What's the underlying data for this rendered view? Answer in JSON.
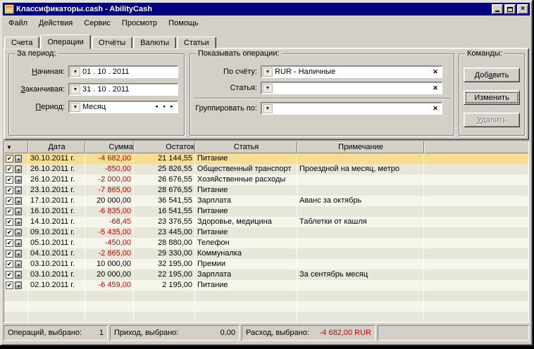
{
  "icons": {
    "dropdown": "▼",
    "clear": "✕",
    "spin_left": "◄",
    "spin_dot": "●",
    "spin_right": "►",
    "check": "✔",
    "sort": "▼"
  },
  "colors": {
    "titlebar": "#000080",
    "chrome": "#d4d0c8",
    "negative_red": "#cc0000",
    "selected_row": "#f5dd95",
    "stripe_dark": "#e7e7d9",
    "stripe_light": "#f5f5ec"
  },
  "window": {
    "title": "Классификаторы.cash - AbilityCash"
  },
  "menu": {
    "items": [
      "Файл",
      "Действия",
      "Сервис",
      "Просмотр",
      "Помощь"
    ]
  },
  "tabs": [
    {
      "label": "Счета",
      "active": false
    },
    {
      "label": "Операции",
      "active": true
    },
    {
      "label": "Отчёты",
      "active": false
    },
    {
      "label": "Валюты",
      "active": false
    },
    {
      "label": "Статьи",
      "active": false
    }
  ],
  "period_group": {
    "title": "За период:",
    "fields": [
      {
        "label": "Начиная:",
        "value": "01 . 10 . 2011"
      },
      {
        "label": "Заканчивая:",
        "value": "31 . 10 . 2011"
      },
      {
        "label": "Период:",
        "value": "Месяц"
      }
    ]
  },
  "filter_group": {
    "title": "Показывать операции:",
    "fields": [
      {
        "label": "По счёту:",
        "value": "RUR - Наличные"
      },
      {
        "label": "Статья:",
        "value": ""
      },
      {
        "label": "Группировать по:",
        "value": ""
      }
    ]
  },
  "commands_group": {
    "title": "Команды:",
    "buttons": [
      {
        "label": "Добавить",
        "focused": false,
        "disabled": false
      },
      {
        "label": "Изменить",
        "focused": true,
        "disabled": false
      },
      {
        "label": "Удалить",
        "focused": false,
        "disabled": true
      }
    ]
  },
  "table": {
    "columns": [
      "",
      "Дата",
      "Сумма",
      "Остаток",
      "Статья",
      "Примечание",
      ""
    ],
    "rows": [
      {
        "checked": true,
        "date": "30.10.2011 г.",
        "sum": "-4 682,00",
        "balance": "21 144,55",
        "category": "Питание",
        "note": "",
        "selected": true
      },
      {
        "checked": true,
        "date": "26.10.2011 г.",
        "sum": "-850,00",
        "balance": "25 826,55",
        "category": "Общественный транспорт",
        "note": "Проездной на месяц, метро",
        "selected": false
      },
      {
        "checked": true,
        "date": "26.10.2011 г.",
        "sum": "-2 000,00",
        "balance": "26 676,55",
        "category": "Хозяйственные расходы",
        "note": "",
        "selected": false
      },
      {
        "checked": true,
        "date": "23.10.2011 г.",
        "sum": "-7 865,00",
        "balance": "28 676,55",
        "category": "Питание",
        "note": "",
        "selected": false
      },
      {
        "checked": true,
        "date": "17.10.2011 г.",
        "sum": "20 000,00",
        "balance": "36 541,55",
        "category": "Зарплата",
        "note": "Аванс за октябрь",
        "selected": false
      },
      {
        "checked": true,
        "date": "16.10.2011 г.",
        "sum": "-6 835,00",
        "balance": "16 541,55",
        "category": "Питание",
        "note": "",
        "selected": false
      },
      {
        "checked": true,
        "date": "14.10.2011 г.",
        "sum": "-68,45",
        "balance": "23 376,55",
        "category": "Здоровье, медицина",
        "note": "Таблетки от кашля",
        "selected": false
      },
      {
        "checked": true,
        "date": "09.10.2011 г.",
        "sum": "-5 435,00",
        "balance": "23 445,00",
        "category": "Питание",
        "note": "",
        "selected": false
      },
      {
        "checked": true,
        "date": "05.10.2011 г.",
        "sum": "-450,00",
        "balance": "28 880,00",
        "category": "Телефон",
        "note": "",
        "selected": false
      },
      {
        "checked": true,
        "date": "04.10.2011 г.",
        "sum": "-2 865,00",
        "balance": "29 330,00",
        "category": "Коммуналка",
        "note": "",
        "selected": false
      },
      {
        "checked": true,
        "date": "03.10.2011 г.",
        "sum": "10 000,00",
        "balance": "32 195,00",
        "category": "Премии",
        "note": "",
        "selected": false
      },
      {
        "checked": true,
        "date": "03.10.2011 г.",
        "sum": "20 000,00",
        "balance": "22 195,00",
        "category": "Зарплата",
        "note": "За сентябрь месяц",
        "selected": false
      },
      {
        "checked": true,
        "date": "02.10.2011 г.",
        "sum": "-6 459,00",
        "balance": "2 195,00",
        "category": "Питание",
        "note": "",
        "selected": false
      }
    ]
  },
  "statusbar": {
    "panels": [
      {
        "label": "Операций, выбрано:",
        "value": "1",
        "negative": false
      },
      {
        "label": "Приход, выбрано:",
        "value": "0,00",
        "negative": false
      },
      {
        "label": "Расход, выбрано:",
        "value": "-4 682,00 RUR",
        "negative": true
      }
    ]
  }
}
